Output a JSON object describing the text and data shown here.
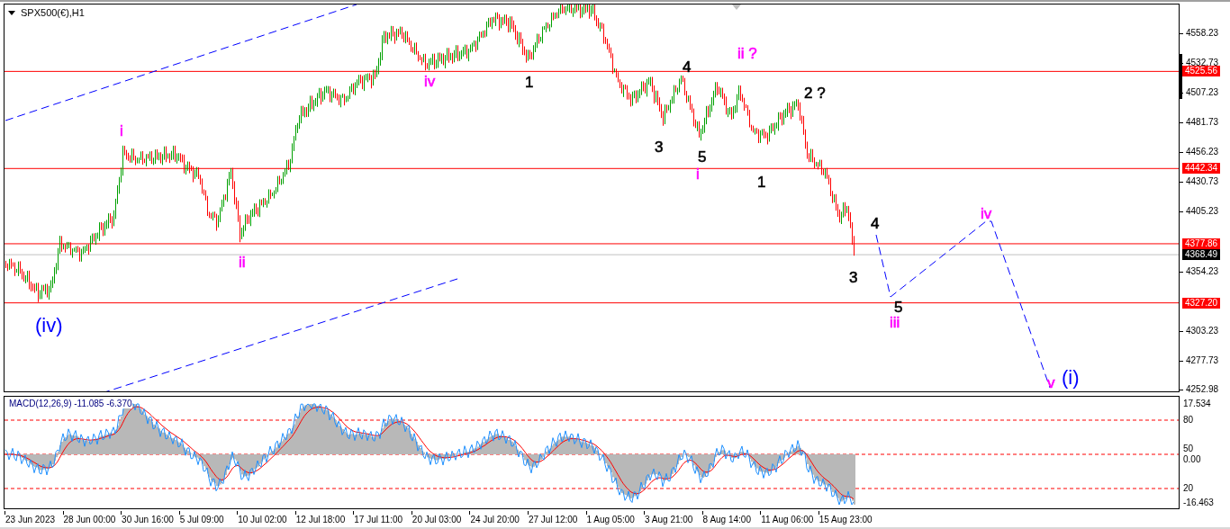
{
  "symbol_title": "SPX500(€),H1",
  "price_axis": {
    "ticks": [
      "4558.23",
      "4532.73",
      "4507.23",
      "4481.73",
      "4456.23",
      "4430.73",
      "4405.23",
      "4354.23",
      "4303.23",
      "4277.73",
      "4252.98"
    ]
  },
  "price_levels": [
    {
      "label": "4525.56",
      "kind": "level"
    },
    {
      "label": "4442.34",
      "kind": "level"
    },
    {
      "label": "4377.86",
      "kind": "level"
    },
    {
      "label": "4368.49",
      "kind": "current"
    },
    {
      "label": "4327.20",
      "kind": "level"
    }
  ],
  "wave_labels": [
    {
      "text": "i",
      "color": "#ff00ff"
    },
    {
      "text": "ii",
      "color": "#ff00ff"
    },
    {
      "text": "iv",
      "color": "#ff00ff"
    },
    {
      "text": "1",
      "color": "#000000"
    },
    {
      "text": "3",
      "color": "#000000"
    },
    {
      "text": "4",
      "color": "#000000"
    },
    {
      "text": "5",
      "color": "#000000"
    },
    {
      "text": "i",
      "color": "#ff00ff"
    },
    {
      "text": "ii ?",
      "color": "#ff00ff"
    },
    {
      "text": "1",
      "color": "#000000"
    },
    {
      "text": "2 ?",
      "color": "#000000"
    },
    {
      "text": "4",
      "color": "#000000"
    },
    {
      "text": "3",
      "color": "#000000"
    },
    {
      "text": "5",
      "color": "#000000"
    },
    {
      "text": "iii",
      "color": "#ff00ff"
    },
    {
      "text": "iv",
      "color": "#ff00ff"
    },
    {
      "text": "v",
      "color": "#ff00ff"
    },
    {
      "text": "(i)",
      "color": "#0000ff"
    },
    {
      "text": "(iv)",
      "color": "#0000ff"
    }
  ],
  "macd_panel": {
    "legend": "MACD(12,26,9) -11.085 -6.370",
    "axis_labels": [
      "17.534",
      "80",
      "50",
      "0.00",
      "20",
      "-16.463"
    ]
  },
  "time_axis": {
    "labels": [
      "23 Jun 2023",
      "28 Jun 00:00",
      "30 Jun 16:00",
      "5 Jul 09:00",
      "10 Jul 02:00",
      "12 Jul 18:00",
      "17 Jul 11:00",
      "20 Jul 03:00",
      "24 Jul 20:00",
      "27 Jul 12:00",
      "1 Aug 05:00",
      "3 Aug 21:00",
      "8 Aug 14:00",
      "11 Aug 06:00",
      "15 Aug 23:00"
    ]
  }
}
